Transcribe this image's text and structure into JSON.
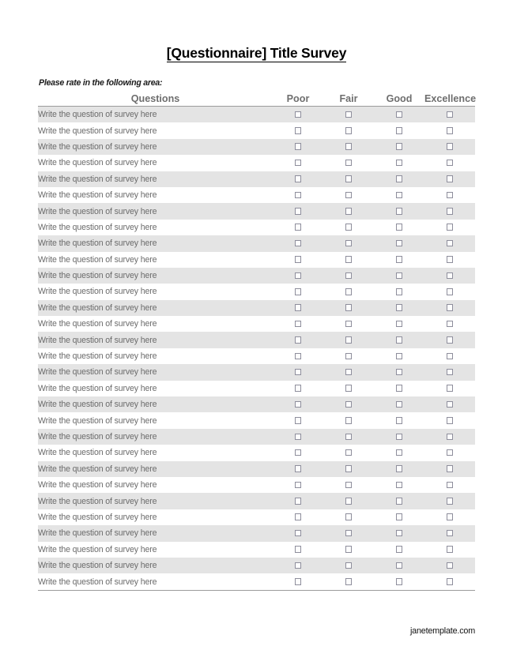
{
  "document": {
    "title": "[Questionnaire] Title Survey",
    "instruction": "Please rate in the following area:",
    "footer": "janetemplate.com"
  },
  "table": {
    "headers": {
      "questions": "Questions",
      "poor": "Poor",
      "fair": "Fair",
      "good": "Good",
      "excellence": "Excellence"
    },
    "rating_columns": [
      "Poor",
      "Fair",
      "Good",
      "Excellence"
    ],
    "row_label": "Write the question of survey here",
    "row_count": 30,
    "rows": [
      {
        "question": "Write the question of survey here",
        "shaded": true,
        "poor": false,
        "fair": false,
        "good": false,
        "excellence": false
      },
      {
        "question": "Write the question of survey here",
        "shaded": false,
        "poor": false,
        "fair": false,
        "good": false,
        "excellence": false
      },
      {
        "question": "Write the question of survey here",
        "shaded": true,
        "poor": false,
        "fair": false,
        "good": false,
        "excellence": false
      },
      {
        "question": "Write the question of survey here",
        "shaded": false,
        "poor": false,
        "fair": false,
        "good": false,
        "excellence": false
      },
      {
        "question": "Write the question of survey here",
        "shaded": true,
        "poor": false,
        "fair": false,
        "good": false,
        "excellence": false
      },
      {
        "question": "Write the question of survey here",
        "shaded": false,
        "poor": false,
        "fair": false,
        "good": false,
        "excellence": false
      },
      {
        "question": "Write the question of survey here",
        "shaded": true,
        "poor": false,
        "fair": false,
        "good": false,
        "excellence": false
      },
      {
        "question": "Write the question of survey here",
        "shaded": false,
        "poor": false,
        "fair": false,
        "good": false,
        "excellence": false
      },
      {
        "question": "Write the question of survey here",
        "shaded": true,
        "poor": false,
        "fair": false,
        "good": false,
        "excellence": false
      },
      {
        "question": "Write the question of survey here",
        "shaded": false,
        "poor": false,
        "fair": false,
        "good": false,
        "excellence": false
      },
      {
        "question": "Write the question of survey here",
        "shaded": true,
        "poor": false,
        "fair": false,
        "good": false,
        "excellence": false
      },
      {
        "question": "Write the question of survey here",
        "shaded": false,
        "poor": false,
        "fair": false,
        "good": false,
        "excellence": false
      },
      {
        "question": "Write the question of survey here",
        "shaded": true,
        "poor": false,
        "fair": false,
        "good": false,
        "excellence": false
      },
      {
        "question": "Write the question of survey here",
        "shaded": false,
        "poor": false,
        "fair": false,
        "good": false,
        "excellence": false
      },
      {
        "question": "Write the question of survey here",
        "shaded": true,
        "poor": false,
        "fair": false,
        "good": false,
        "excellence": false
      },
      {
        "question": "Write the question of survey here",
        "shaded": false,
        "poor": false,
        "fair": false,
        "good": false,
        "excellence": false
      },
      {
        "question": "Write the question of survey here",
        "shaded": true,
        "poor": false,
        "fair": false,
        "good": false,
        "excellence": false
      },
      {
        "question": "Write the question of survey here",
        "shaded": false,
        "poor": false,
        "fair": false,
        "good": false,
        "excellence": false
      },
      {
        "question": "Write the question of survey here",
        "shaded": true,
        "poor": false,
        "fair": false,
        "good": false,
        "excellence": false
      },
      {
        "question": "Write the question of survey here",
        "shaded": false,
        "poor": false,
        "fair": false,
        "good": false,
        "excellence": false
      },
      {
        "question": "Write the question of survey here",
        "shaded": true,
        "poor": false,
        "fair": false,
        "good": false,
        "excellence": false
      },
      {
        "question": "Write the question of survey here",
        "shaded": false,
        "poor": false,
        "fair": false,
        "good": false,
        "excellence": false
      },
      {
        "question": "Write the question of survey here",
        "shaded": true,
        "poor": false,
        "fair": false,
        "good": false,
        "excellence": false
      },
      {
        "question": "Write the question of survey here",
        "shaded": false,
        "poor": false,
        "fair": false,
        "good": false,
        "excellence": false
      },
      {
        "question": "Write the question of survey here",
        "shaded": true,
        "poor": false,
        "fair": false,
        "good": false,
        "excellence": false
      },
      {
        "question": "Write the question of survey here",
        "shaded": false,
        "poor": false,
        "fair": false,
        "good": false,
        "excellence": false
      },
      {
        "question": "Write the question of survey here",
        "shaded": true,
        "poor": false,
        "fair": false,
        "good": false,
        "excellence": false
      },
      {
        "question": "Write the question of survey here",
        "shaded": false,
        "poor": false,
        "fair": false,
        "good": false,
        "excellence": false
      },
      {
        "question": "Write the question of survey here",
        "shaded": true,
        "poor": false,
        "fair": false,
        "good": false,
        "excellence": false
      },
      {
        "question": "Write the question of survey here",
        "shaded": false,
        "poor": false,
        "fair": false,
        "good": false,
        "excellence": false
      }
    ]
  },
  "colors": {
    "header_text": "#6e6e6e",
    "row_text": "#6b6b6b",
    "shaded_row": "#e4e4e4",
    "rule": "#9b9b9b",
    "checkbox_border": "#8e8e9c"
  }
}
